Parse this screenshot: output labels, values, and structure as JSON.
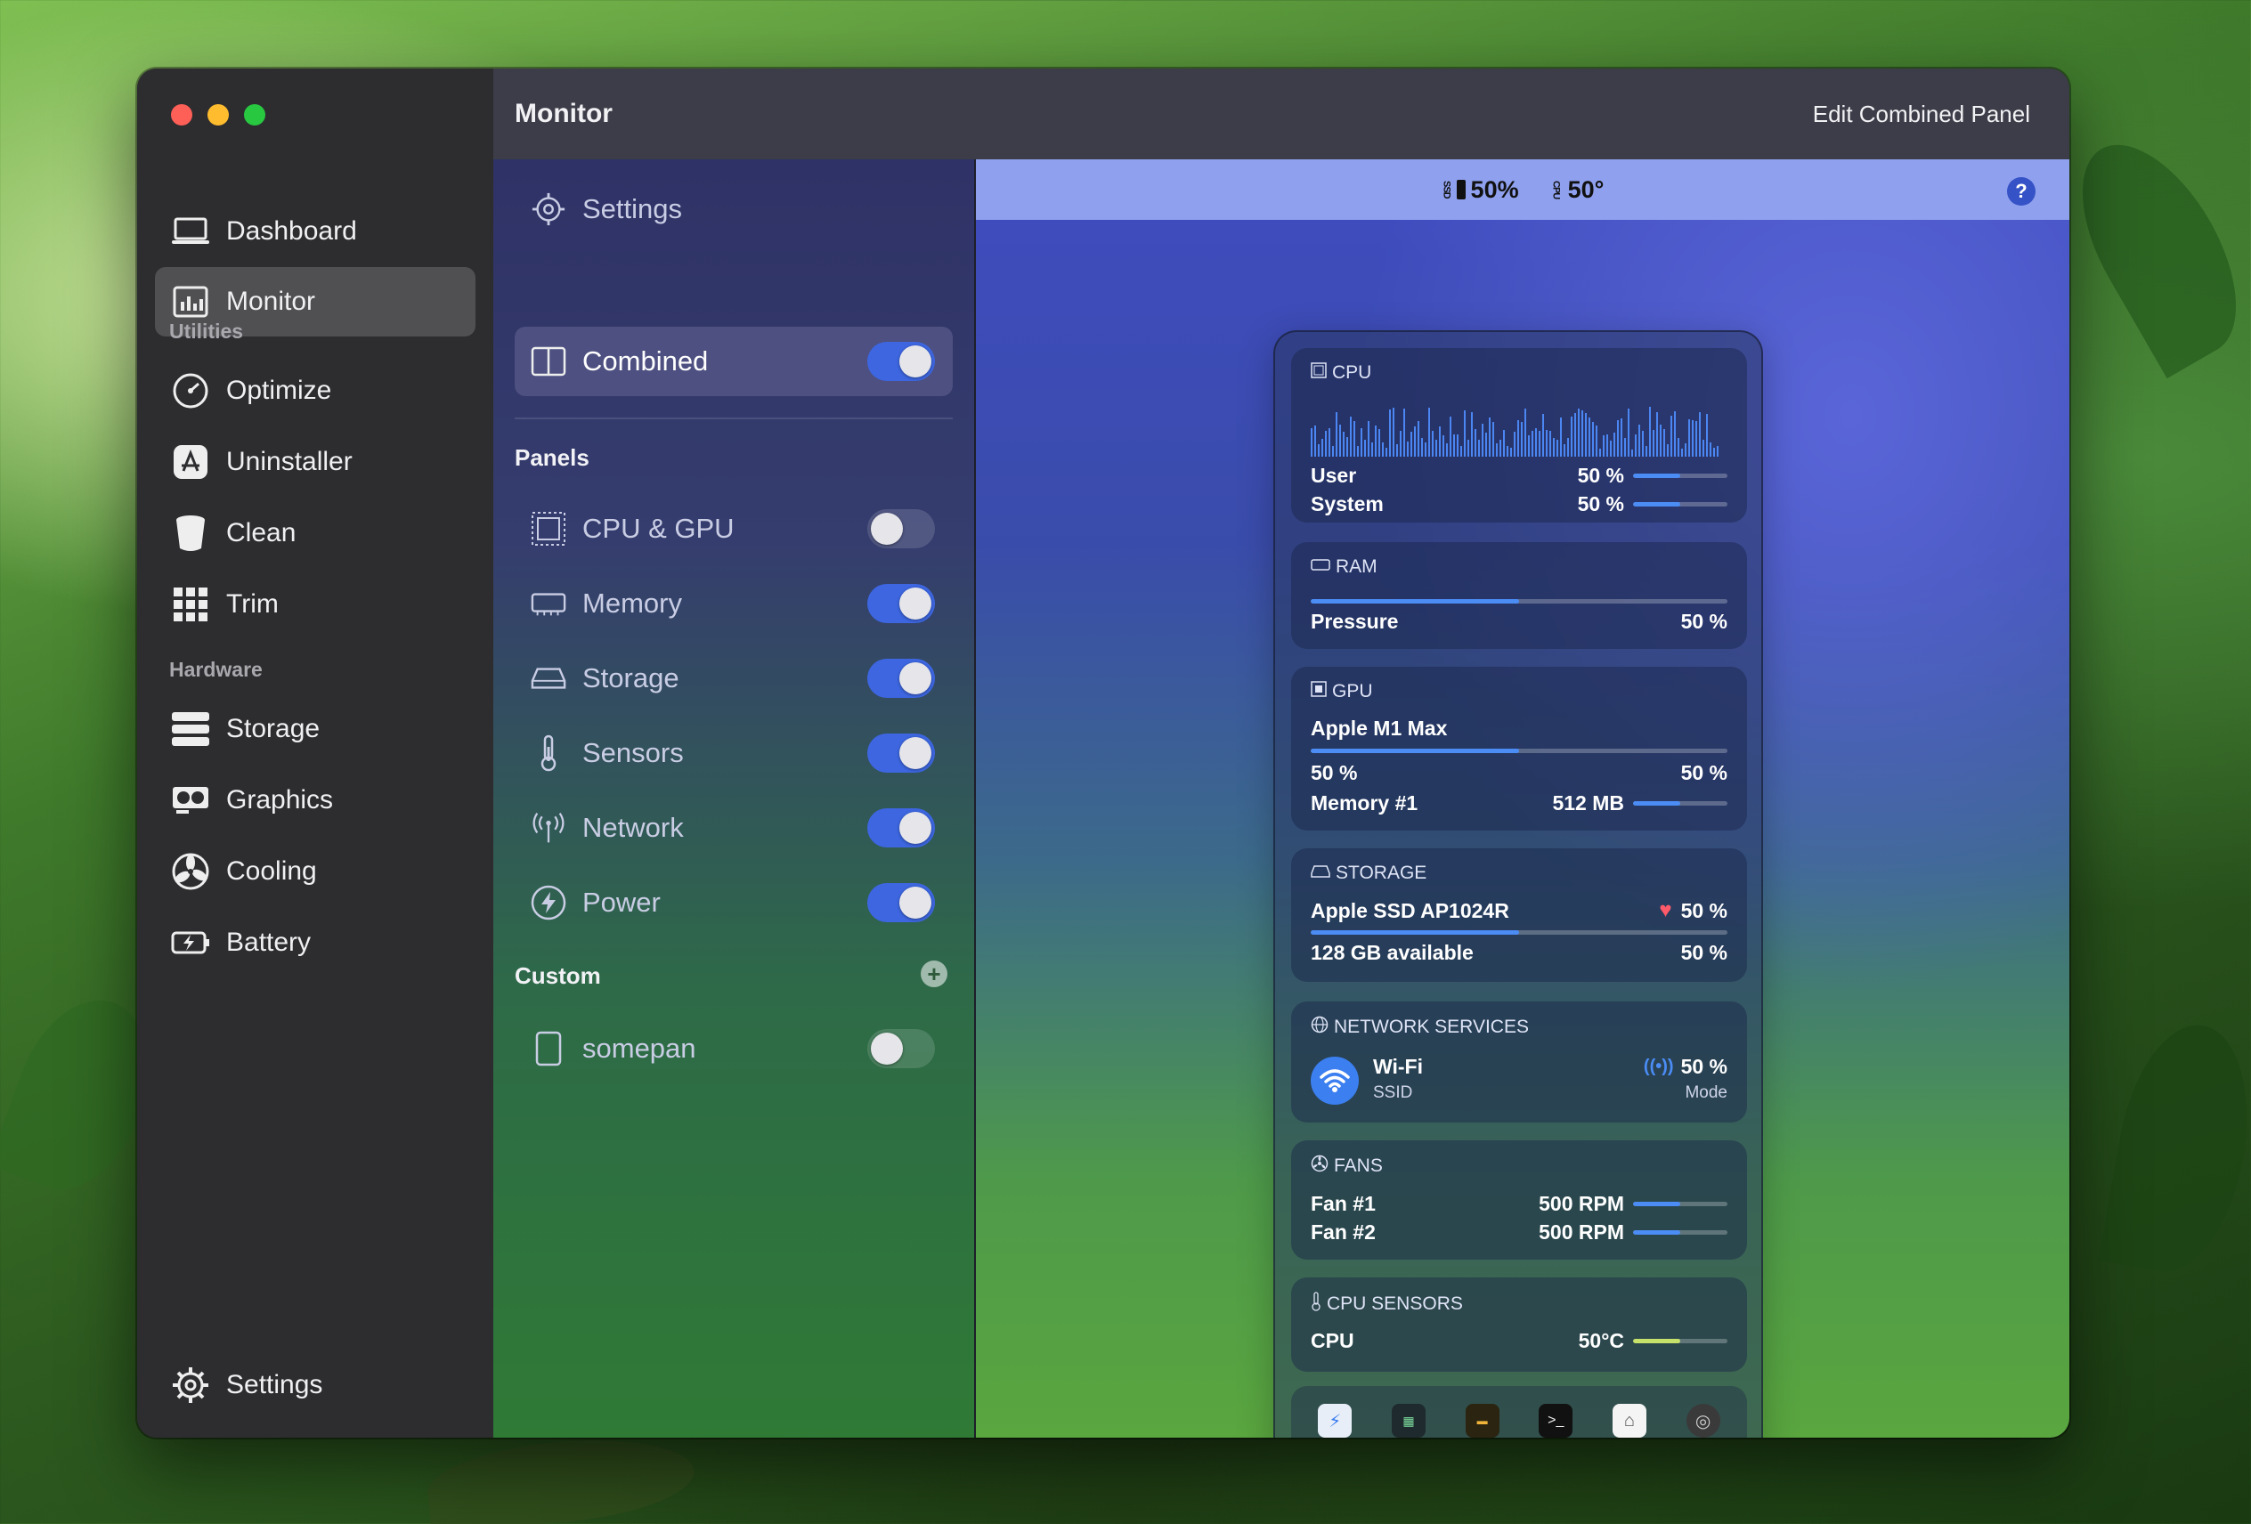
{
  "window": {
    "title": "Monitor",
    "edit_label": "Edit Combined Panel"
  },
  "sidebar": {
    "items": [
      {
        "label": "Dashboard",
        "icon": "laptop-icon"
      },
      {
        "label": "Monitor",
        "icon": "monitor-chart-icon",
        "active": true
      }
    ],
    "section_utilities": "Utilities",
    "utilities": [
      {
        "label": "Optimize",
        "icon": "gauge-icon"
      },
      {
        "label": "Uninstaller",
        "icon": "app-store-icon"
      },
      {
        "label": "Clean",
        "icon": "bucket-icon"
      },
      {
        "label": "Trim",
        "icon": "grid-icon"
      }
    ],
    "section_hardware": "Hardware",
    "hardware": [
      {
        "label": "Storage",
        "icon": "storage-stack-icon"
      },
      {
        "label": "Graphics",
        "icon": "graphics-card-icon"
      },
      {
        "label": "Cooling",
        "icon": "fan-icon"
      },
      {
        "label": "Battery",
        "icon": "battery-icon"
      }
    ],
    "settings": "Settings"
  },
  "middle": {
    "settings": "Settings",
    "combined": "Combined",
    "panels_heading": "Panels",
    "panels": [
      {
        "label": "CPU & GPU",
        "icon": "cpu-chip-icon",
        "on": false
      },
      {
        "label": "Memory",
        "icon": "memory-chip-icon",
        "on": true
      },
      {
        "label": "Storage",
        "icon": "drive-icon",
        "on": true
      },
      {
        "label": "Sensors",
        "icon": "thermometer-icon",
        "on": true
      },
      {
        "label": "Network",
        "icon": "antenna-icon",
        "on": true
      },
      {
        "label": "Power",
        "icon": "bolt-icon",
        "on": true
      }
    ],
    "custom_heading": "Custom",
    "custom_items": [
      {
        "label": "somepan",
        "icon": "panel-icon",
        "on": false
      }
    ]
  },
  "statusbar": {
    "ssd_label": "SSD",
    "ssd_value": "50%",
    "cpu_label": "CPU",
    "cpu_value": "50°"
  },
  "widget": {
    "cpu": {
      "title": "CPU",
      "user_label": "User",
      "user_value": "50 %",
      "user_level": 0.5,
      "system_label": "System",
      "system_value": "50 %",
      "system_level": 0.5
    },
    "ram": {
      "title": "RAM",
      "pressure_label": "Pressure",
      "pressure_value": "50 %",
      "level": 0.5
    },
    "gpu": {
      "title": "GPU",
      "name": "Apple M1 Max",
      "left_value": "50 %",
      "right_value": "50 %",
      "level": 0.5,
      "memory_label": "Memory #1",
      "memory_value": "512 MB",
      "memory_level": 0.5
    },
    "storage": {
      "title": "STORAGE",
      "name": "Apple SSD AP1024R",
      "health_value": "50 %",
      "level": 0.5,
      "available_label": "128 GB available",
      "available_value": "50 %"
    },
    "network": {
      "title": "NETWORK SERVICES",
      "name": "Wi-Fi",
      "ssid_label": "SSID",
      "signal_value": "50 %",
      "mode_label": "Mode"
    },
    "fans": {
      "title": "FANS",
      "items": [
        {
          "label": "Fan #1",
          "value": "500 RPM",
          "level": 0.5
        },
        {
          "label": "Fan #2",
          "value": "500 RPM",
          "level": 0.5
        }
      ]
    },
    "sensors": {
      "title": "CPU SENSORS",
      "label": "CPU",
      "value": "50°C",
      "level": 0.5
    },
    "dock_icons": [
      "app-icon-1",
      "app-icon-2",
      "app-icon-3",
      "terminal-icon",
      "app-icon-5",
      "app-icon-6"
    ]
  },
  "colors": {
    "accent": "#3d66e0",
    "bar": "#4b8cf5",
    "sensor_bar": "#c7e26a"
  }
}
